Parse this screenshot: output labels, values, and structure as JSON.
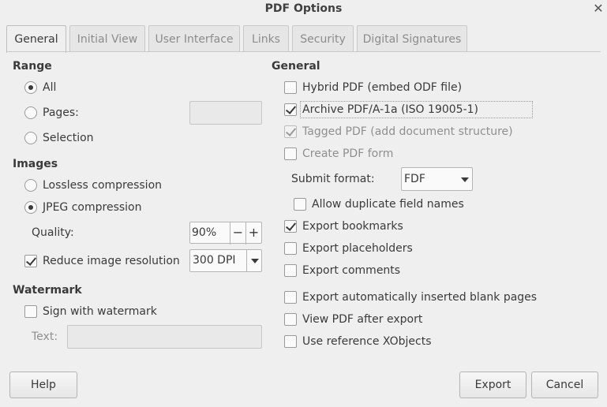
{
  "window": {
    "title": "PDF Options"
  },
  "tabs": [
    {
      "label": "General"
    },
    {
      "label": "Initial View"
    },
    {
      "label": "User Interface"
    },
    {
      "label": "Links"
    },
    {
      "label": "Security"
    },
    {
      "label": "Digital Signatures"
    }
  ],
  "range": {
    "heading": "Range",
    "all_label": "All",
    "pages_label": "Pages:",
    "pages_value": "",
    "selection_label": "Selection",
    "selected": "All"
  },
  "images": {
    "heading": "Images",
    "lossless_label": "Lossless compression",
    "jpeg_label": "JPEG compression",
    "selected": "JPEG compression",
    "quality_label": "Quality:",
    "quality_value": "90%",
    "reduce_label": "Reduce image resolution",
    "reduce_checked": true,
    "resolution_value": "300 DPI"
  },
  "watermark": {
    "heading": "Watermark",
    "sign_label": "Sign with watermark",
    "sign_checked": false,
    "text_label": "Text:",
    "text_value": ""
  },
  "general": {
    "heading": "General",
    "hybrid_label": "Hybrid PDF (embed ODF file)",
    "hybrid_checked": false,
    "archive_label": "Archive PDF/A-1a (ISO 19005-1)",
    "archive_checked": true,
    "tagged_label": "Tagged PDF (add document structure)",
    "tagged_checked": true,
    "form_label": "Create PDF form",
    "form_checked": false,
    "submit_label": "Submit format:",
    "submit_value": "FDF",
    "duplicate_label": "Allow duplicate field names",
    "duplicate_checked": false,
    "bookmarks_label": "Export bookmarks",
    "bookmarks_checked": true,
    "placeholders_label": "Export placeholders",
    "placeholders_checked": false,
    "comments_label": "Export comments",
    "comments_checked": false,
    "blank_label": "Export automatically inserted blank pages",
    "blank_checked": false,
    "view_label": "View PDF after export",
    "view_checked": false,
    "xobjects_label": "Use reference XObjects",
    "xobjects_checked": false
  },
  "buttons": {
    "help": "Help",
    "export": "Export",
    "cancel": "Cancel"
  },
  "icons": {
    "close": "close-icon",
    "minus": "minus-icon",
    "plus": "plus-icon",
    "dropdown": "chevron-down-icon"
  }
}
